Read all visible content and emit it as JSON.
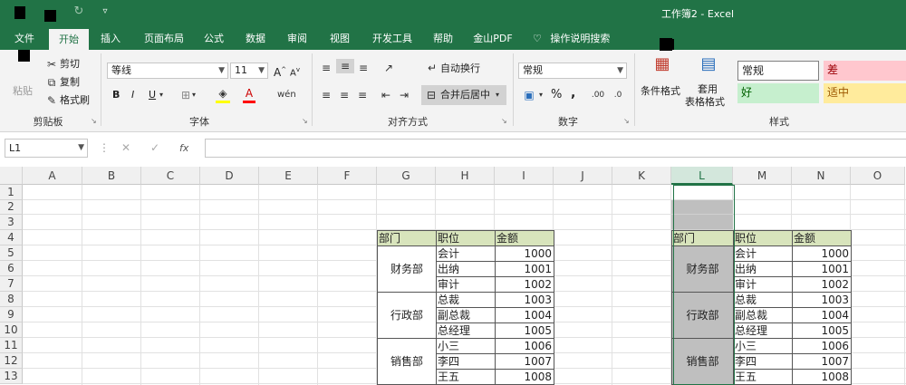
{
  "window": {
    "title": "工作簿2 - Excel"
  },
  "tabs": [
    "文件",
    "开始",
    "插入",
    "页面布局",
    "公式",
    "数据",
    "审阅",
    "视图",
    "开发工具",
    "帮助",
    "金山PDF"
  ],
  "active_tab": "开始",
  "tell_me": "操作说明搜索",
  "clipboard": {
    "paste": "粘贴",
    "cut": "剪切",
    "copy": "复制",
    "format_painter": "格式刷",
    "label": "剪贴板"
  },
  "font": {
    "name": "等线",
    "size": "11",
    "bold": "B",
    "italic": "I",
    "underline": "U",
    "grow": "A",
    "shrink": "A",
    "label": "字体"
  },
  "alignment": {
    "wrap": "自动换行",
    "merge": "合并后居中",
    "label": "对齐方式"
  },
  "number": {
    "format": "常规",
    "percent": "%",
    "comma": ",",
    "label": "数字"
  },
  "styles": {
    "conditional": "条件格式",
    "table_format": "套用",
    "table_format2": "表格格式",
    "normal": "常规",
    "bad": "差",
    "good": "好",
    "neutral": "适中",
    "label": "样式",
    "colors": {
      "bad_bg": "#ffc7ce",
      "bad_fg": "#9c0006",
      "good_bg": "#c6efce",
      "good_fg": "#006100",
      "neutral_bg": "#ffeb9c",
      "neutral_fg": "#9c5700"
    }
  },
  "formula_bar": {
    "name_box": "L1",
    "fx": "fx",
    "formula": ""
  },
  "columns": [
    "A",
    "B",
    "C",
    "D",
    "E",
    "F",
    "G",
    "H",
    "I",
    "J",
    "K",
    "L",
    "M",
    "N",
    "O"
  ],
  "selected_column": "L",
  "rows": [
    "1",
    "2",
    "3",
    "4",
    "5",
    "6",
    "7",
    "8",
    "9",
    "10",
    "11",
    "12",
    "13"
  ],
  "table_left": {
    "headers": [
      "部门",
      "职位",
      "金额"
    ],
    "groups": [
      {
        "dept": "财务部",
        "rows": [
          [
            "会计",
            "1000"
          ],
          [
            "出纳",
            "1001"
          ],
          [
            "审计",
            "1002"
          ]
        ]
      },
      {
        "dept": "行政部",
        "rows": [
          [
            "总裁",
            "1003"
          ],
          [
            "副总裁",
            "1004"
          ],
          [
            "总经理",
            "1005"
          ]
        ]
      },
      {
        "dept": "销售部",
        "rows": [
          [
            "小三",
            "1006"
          ],
          [
            "李四",
            "1007"
          ],
          [
            "王五",
            "1008"
          ]
        ]
      }
    ]
  },
  "table_right": {
    "headers": [
      "部门",
      "职位",
      "金额"
    ],
    "groups": [
      {
        "dept": "财务部",
        "rows": [
          [
            "会计",
            "1000"
          ],
          [
            "出纳",
            "1001"
          ],
          [
            "审计",
            "1002"
          ]
        ]
      },
      {
        "dept": "行政部",
        "rows": [
          [
            "总裁",
            "1003"
          ],
          [
            "副总裁",
            "1004"
          ],
          [
            "总经理",
            "1005"
          ]
        ]
      },
      {
        "dept": "销售部",
        "rows": [
          [
            "小三",
            "1006"
          ],
          [
            "李四",
            "1007"
          ],
          [
            "王五",
            "1008"
          ]
        ]
      }
    ]
  },
  "colors": {
    "accent": "#217346",
    "header_fill": "#d8e4bc",
    "gray_fill": "#bfbfbf"
  }
}
